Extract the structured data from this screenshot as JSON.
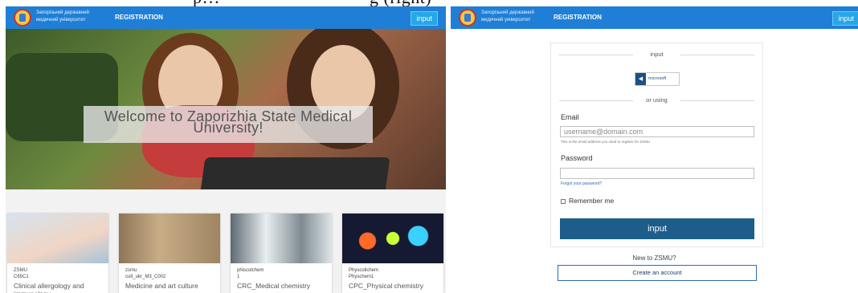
{
  "caption": "Zaporizhia State Medical University home page (left) and login page (right)",
  "header": {
    "university_name_line1": "Запорізький державний",
    "university_name_line2": "медичний університет",
    "registration_label": "REGISTRATION",
    "input_button_label": "input"
  },
  "hero": {
    "welcome_text": "Welcome to Zaporizhia State Medical University!"
  },
  "courses": [
    {
      "category": "ZSMU",
      "code": "C65C1",
      "title": "Clinical allergology and immunology",
      "thumb_color": "#c9d7e6"
    },
    {
      "category": "zsmu",
      "code": "cult_ukr_M3_C002",
      "title": "Medicine and art culture",
      "thumb_color": "#b89a7a"
    },
    {
      "category": "phiscolchem",
      "code": "1",
      "title": "CRC_Medical chemistry",
      "thumb_color": "#9aa3a8"
    },
    {
      "category": "Physcolichem",
      "code": "Physchem1",
      "title": "CPC_Physical chemistry",
      "thumb_color": "#1a1f3a"
    }
  ],
  "login": {
    "section_heading": "input",
    "provider_label": "microsoft",
    "or_using": "or using",
    "email_label": "Email",
    "email_placeholder": "username@domain.com",
    "email_hint": "This is the email address you used to register for ZSMU",
    "password_label": "Password",
    "forgot_link": "Forgot your password?",
    "remember_label": "Remember me",
    "submit_label": "input",
    "new_prompt": "New to ZSMU?",
    "create_account_label": "Create an account"
  },
  "colors": {
    "header_blue": "#1f7fd6",
    "input_button": "#26a7e8",
    "submit_button": "#1c5d89"
  }
}
